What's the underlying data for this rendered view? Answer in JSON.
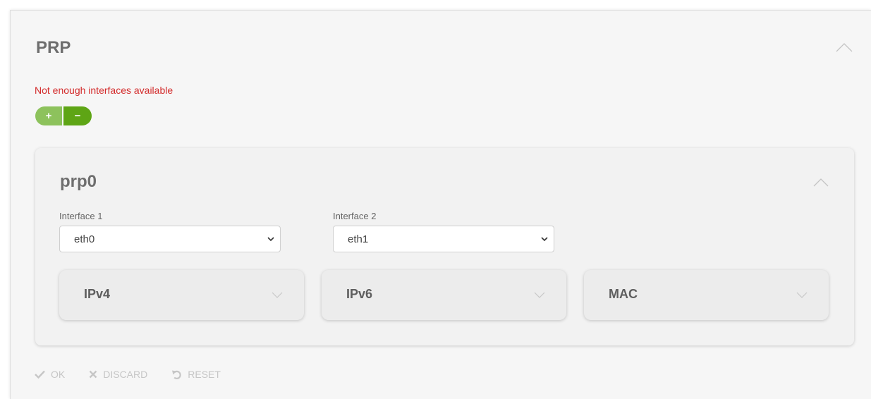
{
  "section": {
    "title": "PRP",
    "warning": "Not enough interfaces available",
    "add_label": "+",
    "remove_label": "−"
  },
  "prp": {
    "title": "prp0",
    "interface1": {
      "label": "Interface 1",
      "value": "eth0"
    },
    "interface2": {
      "label": "Interface 2",
      "value": "eth1"
    },
    "subsections": [
      {
        "label": "IPv4"
      },
      {
        "label": "IPv6"
      },
      {
        "label": "MAC"
      }
    ]
  },
  "actions": {
    "ok_label": "OK",
    "discard_label": "DISCARD",
    "reset_label": "RESET"
  },
  "colors": {
    "warning": "#d32a2a",
    "add_button": "#8dc25c",
    "remove_button": "#5ea515"
  }
}
